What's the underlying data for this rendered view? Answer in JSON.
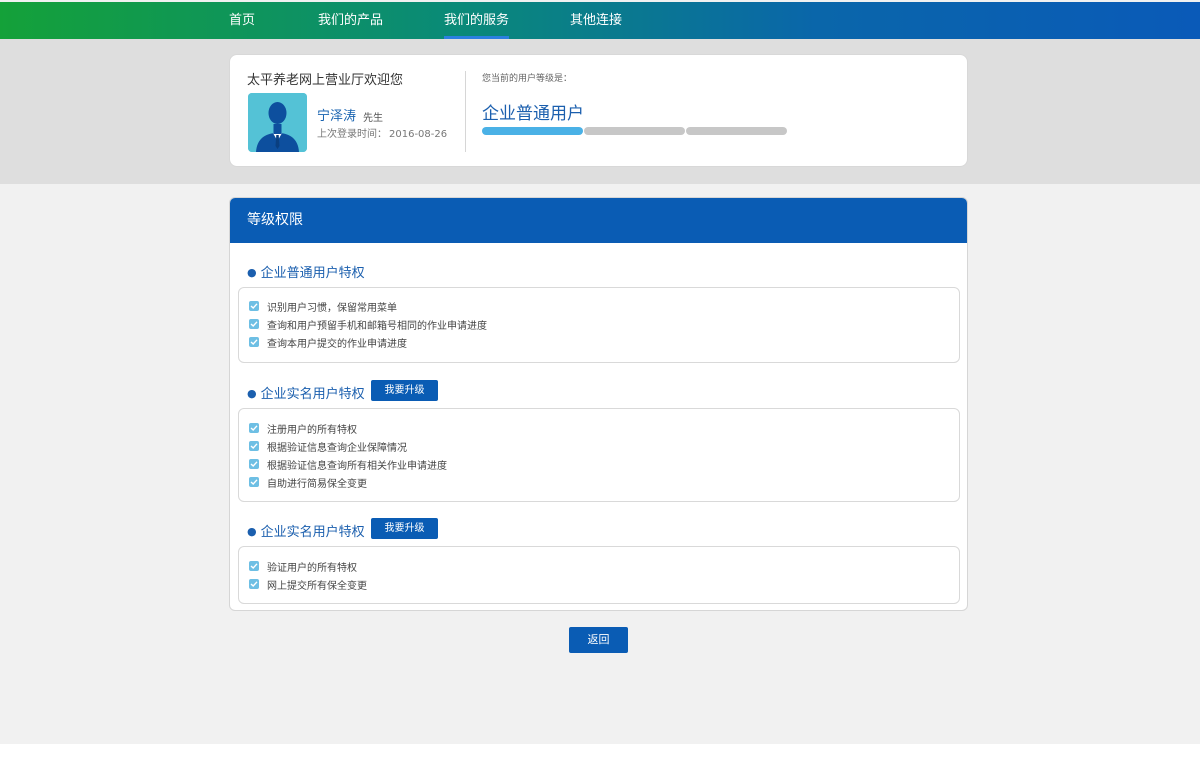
{
  "nav": {
    "items": [
      {
        "label": "首页"
      },
      {
        "label": "我们的产品"
      },
      {
        "label": "我们的服务",
        "active": true
      },
      {
        "label": "其他连接"
      }
    ]
  },
  "user_card": {
    "welcome": "太平养老网上营业厅欢迎您",
    "username": "宁泽涛",
    "honorific": "先生",
    "last_login_label": "上次登录时间：",
    "last_login_date": "2016-08-26",
    "level_label": "您当前的用户等级是：",
    "level_name": "企业普通用户",
    "level_progress": "1/3"
  },
  "privileges": {
    "title": "等级权限",
    "sections": [
      {
        "title": "企业普通用户特权",
        "items": [
          "识别用户习惯，保留常用菜单",
          "查询和用户预留手机和邮箱号相同的作业申请进度",
          "查询本用户提交的作业申请进度"
        ]
      },
      {
        "title": "企业实名用户特权",
        "upgrade_label": "我要升级",
        "items": [
          "注册用户的所有特权",
          "根据验证信息查询企业保障情况",
          "根据验证信息查询所有相关作业申请进度",
          "自助进行简易保全变更"
        ]
      },
      {
        "title": "企业实名用户特权",
        "upgrade_label": "我要升级",
        "items": [
          "验证用户的所有特权",
          "网上提交所有保全变更"
        ]
      }
    ]
  },
  "back_label": "返回",
  "colors": {
    "nav_gradient_start": "#14a139",
    "nav_gradient_end": "#0a5ab8",
    "primary_blue": "#0a5cb4",
    "progress_fill": "#4ab1e6",
    "progress_empty": "#c7c7c7"
  }
}
